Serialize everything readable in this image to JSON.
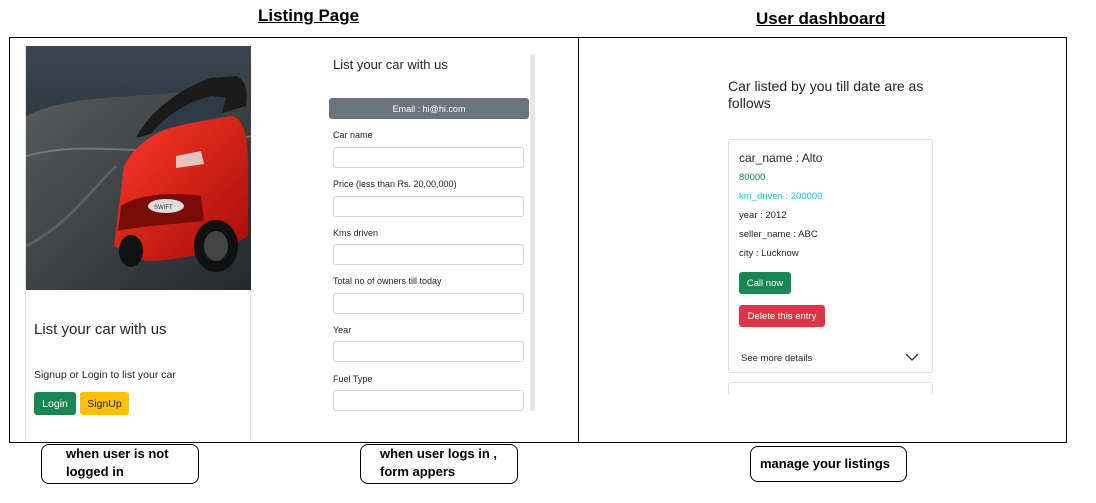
{
  "headings": {
    "listing": "Listing Page",
    "dashboard": "User dashboard"
  },
  "listing_card": {
    "title": "List your car with us",
    "text": "Signup or Login to list your car",
    "login_label": "Login",
    "signup_label": "SignUp"
  },
  "form": {
    "title": "List your car with us",
    "email": "Email : hi@hi.com",
    "fields": [
      {
        "label": "Car name"
      },
      {
        "label": "Price (less than Rs. 20,00,000)"
      },
      {
        "label": "Kms driven"
      },
      {
        "label": "Total no of owners till today"
      },
      {
        "label": "Year"
      },
      {
        "label": "Fuel Type"
      }
    ]
  },
  "dashboard": {
    "title": "Car listed by you till date are as follows",
    "listing": {
      "car_name": "car_name : Alto",
      "price": "80000",
      "km_driven": "km_driven : 200000",
      "year": "year : 2012",
      "seller_name": "seller_name : ABC",
      "city": "city : Lucknow",
      "call_label": "Call now",
      "delete_label": "Delete this entry",
      "more_label": "See more details"
    }
  },
  "captions": {
    "not_logged_in": "when user is not logged in",
    "logged_in": "when user logs in , form appers",
    "manage": "manage your listings"
  },
  "colors": {
    "success": "#198754",
    "warning": "#ffc107",
    "danger": "#dc3545",
    "secondary": "#6c757d",
    "info": "#0dcaf0"
  }
}
